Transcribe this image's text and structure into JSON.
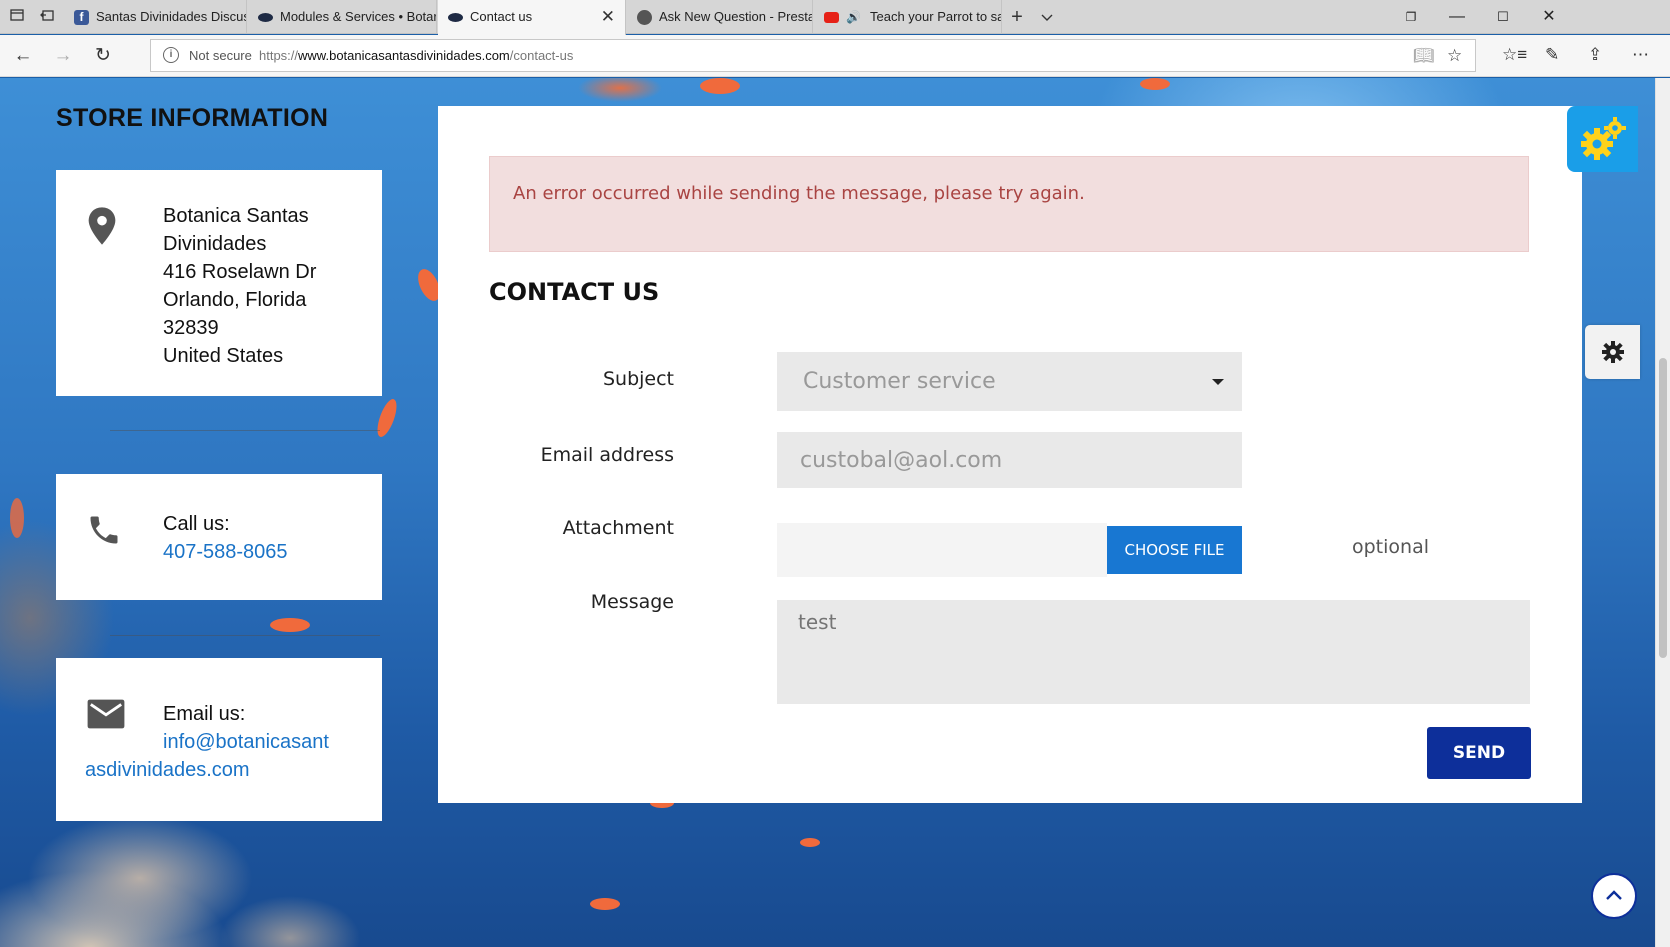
{
  "browser": {
    "tabs": [
      {
        "label": "Santas Divinidades Discussi",
        "favicon_color": "#3b5998"
      },
      {
        "label": "Modules & Services • Botar",
        "favicon_color": "#1e2a44"
      },
      {
        "label": "Contact us",
        "favicon_color": "#1e2a44",
        "active": true
      },
      {
        "label": "Ask New Question - PrestaS",
        "favicon_color": "#555555"
      },
      {
        "label": "Teach your Parrot to sa",
        "favicon_color": "#e62117"
      }
    ],
    "security_label": "Not secure",
    "url_scheme": "https://",
    "url_host": "www.botanicasantasdivinidades.com",
    "url_path": "/contact-us"
  },
  "store": {
    "title": "STORE INFORMATION",
    "address_lines": [
      "Botanica Santas",
      "Divinidades",
      "416 Roselawn Dr",
      "Orlando, Florida",
      "32839",
      "United States"
    ],
    "call_label": "Call us:",
    "phone": "407-588-8065",
    "email_label": "Email us:",
    "email_line1": "info@botanicasant",
    "email_line2": "asdivinidades.com"
  },
  "contact": {
    "error_message": "An error occurred while sending the message, please try again.",
    "title": "CONTACT US",
    "subject_label": "Subject",
    "subject_value": "Customer service",
    "email_label": "Email address",
    "email_placeholder": "custobal@aol.com",
    "attachment_label": "Attachment",
    "choose_file_label": "CHOOSE FILE",
    "optional_label": "optional",
    "message_label": "Message",
    "message_placeholder": "test",
    "send_label": "SEND"
  },
  "colors": {
    "accent_blue": "#1877d2",
    "send_navy": "#0d2f9a",
    "error_bg": "#f2dede",
    "error_text": "#a94442",
    "link": "#1a73c7",
    "gear_widget": "#1a9ee8",
    "gear_yellow": "#ffd21a"
  }
}
